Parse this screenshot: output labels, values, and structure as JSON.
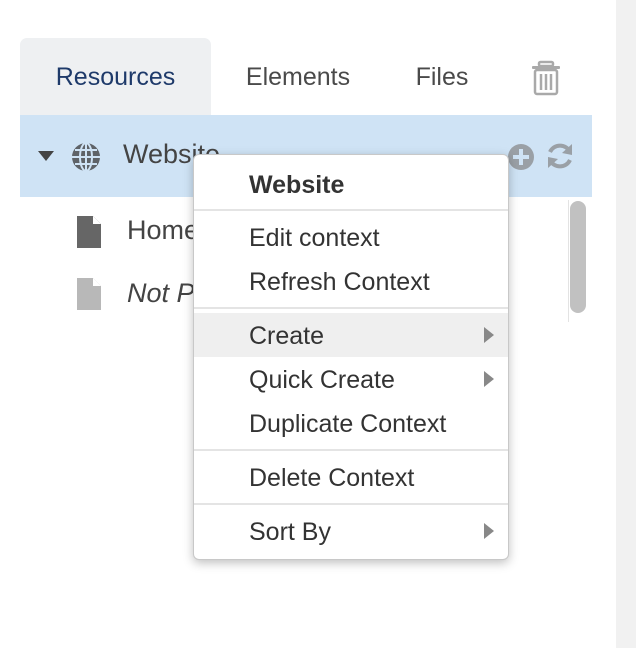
{
  "tabs": [
    {
      "label": "Resources",
      "active": true
    },
    {
      "label": "Elements",
      "active": false
    },
    {
      "label": "Files",
      "active": false
    }
  ],
  "tree": {
    "root_label": "Website",
    "items": [
      {
        "label": "Home"
      },
      {
        "label": "Not P"
      }
    ]
  },
  "context_menu": {
    "header": "Website",
    "items": {
      "edit_context": "Edit context",
      "refresh_context": "Refresh Context",
      "create": "Create",
      "quick_create": "Quick Create",
      "duplicate_context": "Duplicate Context",
      "delete_context": "Delete Context",
      "sort_by": "Sort By"
    },
    "hovered_item": "Create"
  },
  "icons": {
    "trash": "trash-icon",
    "caret": "caret-down-icon",
    "globe": "globe-icon",
    "add": "plus-circle-icon",
    "refresh": "refresh-icon",
    "document": "document-icon",
    "submenu": "chevron-right-icon"
  },
  "colors": {
    "active_tab_text": "#1e3a6a",
    "selected_row": "#cfe3f5",
    "menu_hover": "#efefef"
  }
}
